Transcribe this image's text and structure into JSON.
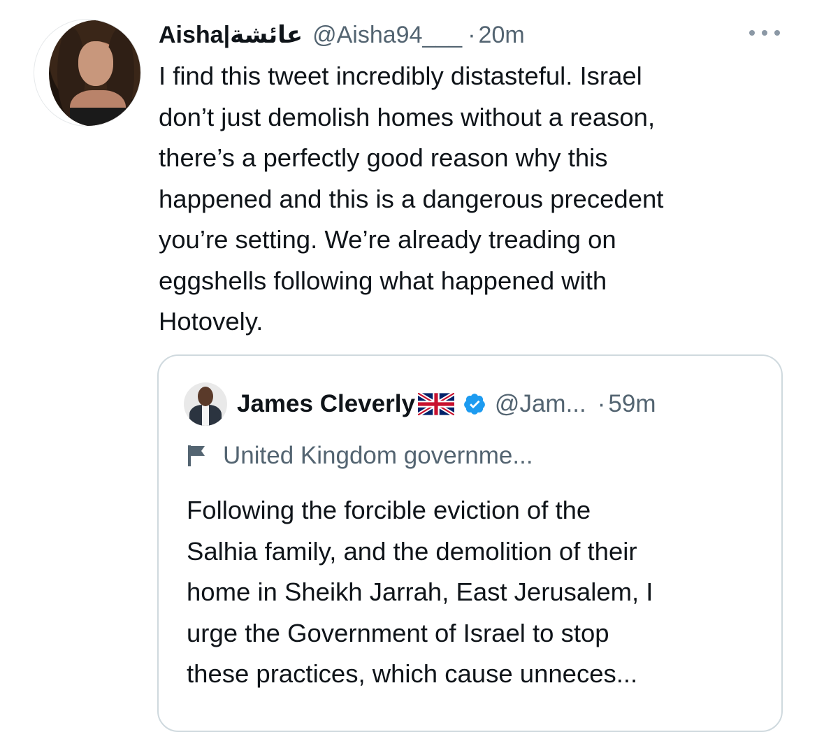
{
  "tweet": {
    "display_name": "Aisha|عائشة",
    "handle": "@Aisha94___",
    "separator": "·",
    "time": "20m",
    "text": "I find this tweet incredibly distasteful. Israel\ndon’t just demolish homes without a reason,\nthere’s a perfectly good reason why this\nhappened and this is a dangerous precedent\nyou’re setting. We’re already treading on\neggshells following what happened with\nHotovely.",
    "more_icon": "ellipsis-icon"
  },
  "quoted_tweet": {
    "display_name": "James Cleverly",
    "flag_emoji": "uk-flag",
    "verified_icon": "verified-badge-icon",
    "handle": "@Jam...",
    "separator": "·",
    "time": "59m",
    "label_icon": "flag-icon",
    "label": "United Kingdom governme...",
    "text": "Following the forcible eviction of the\nSalhia family, and the demolition of their\nhome in Sheikh Jarrah, East Jerusalem, I\nurge the Government of Israel to stop\nthese practices, which cause unneces..."
  },
  "colors": {
    "text_primary": "#0f1419",
    "text_secondary": "#536471",
    "verified_blue": "#1d9bf0",
    "border": "#cfd9de"
  }
}
